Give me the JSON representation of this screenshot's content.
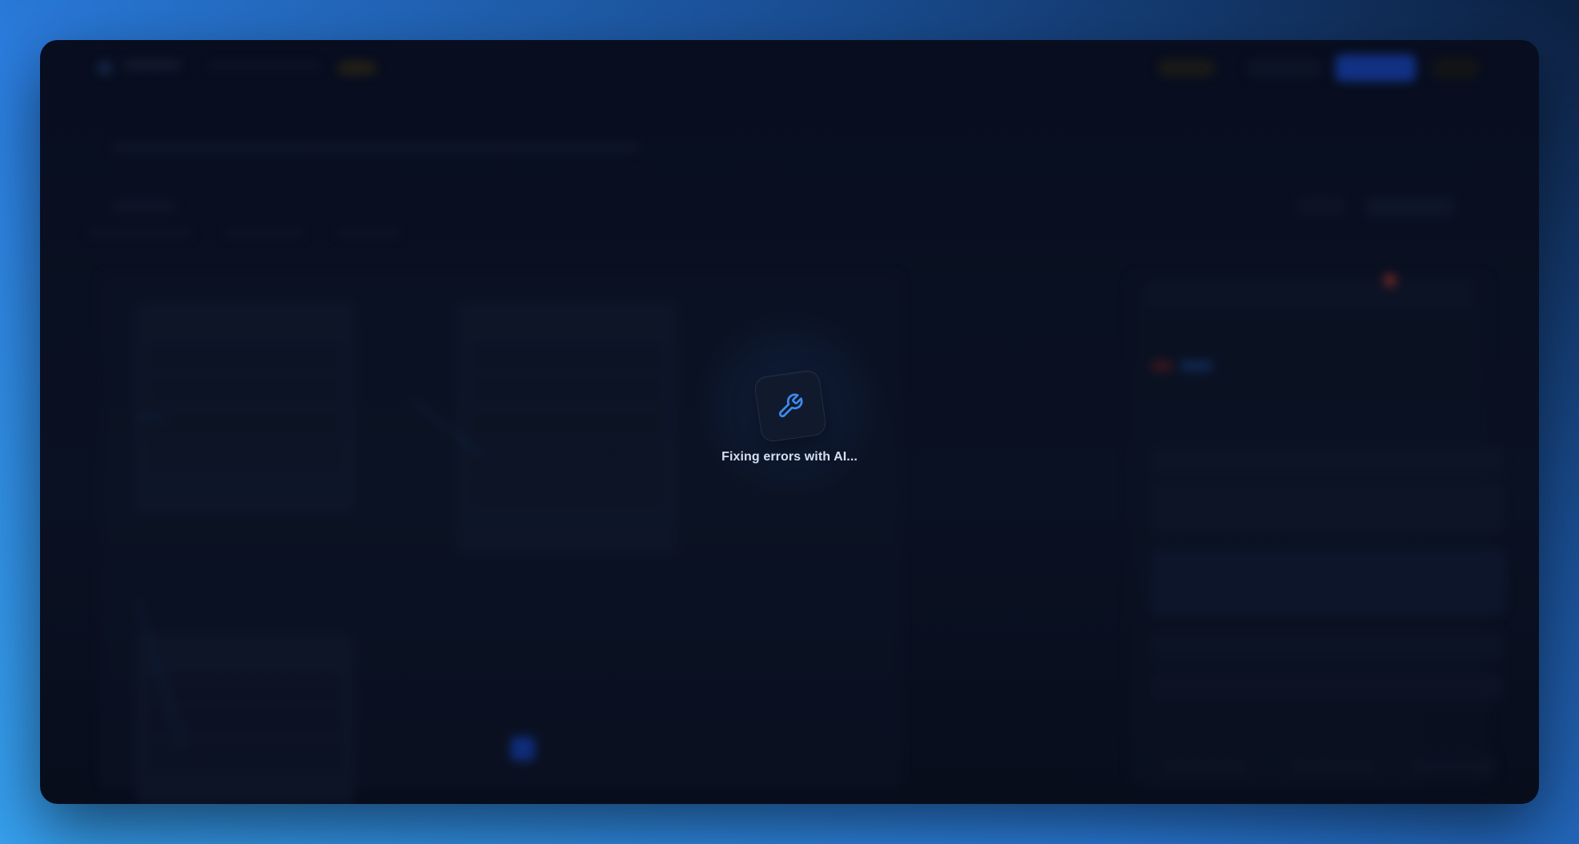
{
  "overlay": {
    "icon": "wrench-icon",
    "status_text": "Fixing errors with AI...",
    "accent_color": "#3d8bf0"
  },
  "colors": {
    "page_background": "#2b7ee0",
    "window_background": "#080e1f",
    "primary_button": "#1a4fd6",
    "error_badge": "#c0392b"
  }
}
